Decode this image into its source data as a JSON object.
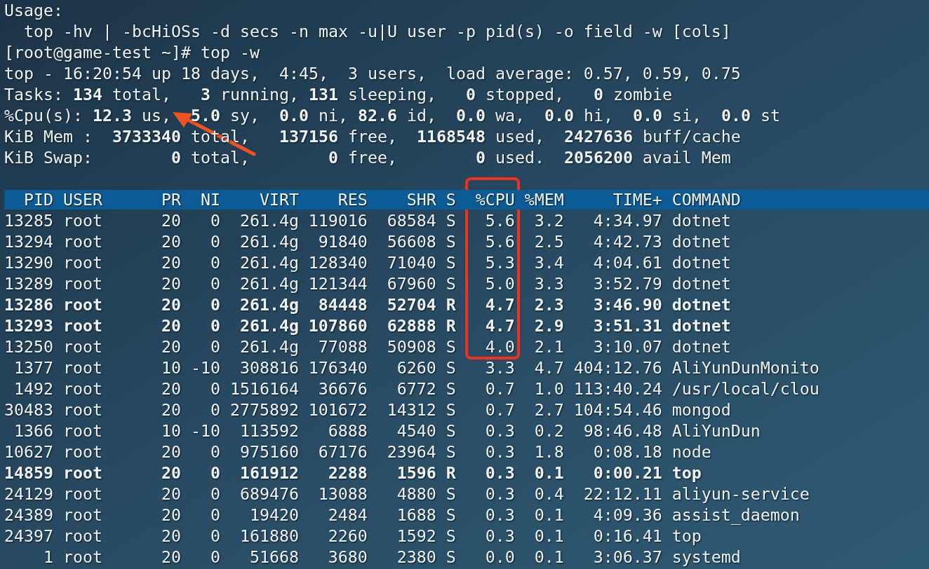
{
  "lines": [
    {
      "text": "Usage:"
    },
    {
      "text": "  top -hv | -bcHiOSs -d secs -n max -u|U user -p pid(s) -o field -w [cols]"
    },
    {
      "text": "[root@game-test ~]# top -w"
    },
    {
      "text": "top - 16:20:54 up 18 days,  4:45,  3 users,  load average: 0.57, 0.59, 0.75"
    },
    {
      "text": "Tasks: **134** total,   **3** running, **131** sleeping,   **0** stopped,   **0** zombie"
    },
    {
      "text": "%Cpu(s): **12.3** us,  **5.0** sy,  **0.0** ni, **82.6** id,  **0.0** wa,  **0.0** hi,  **0.0** si,  **0.0** st",
      "arrow": true
    },
    {
      "text": "KiB Mem :  **3733340** total,   **137156** free,  **1168548** used,  **2427636** buff/cache"
    },
    {
      "text": "KiB Swap:        **0** total,        **0** free,        **0** used.  **2056200** avail Mem"
    }
  ],
  "table": {
    "columns": [
      {
        "label": "PID",
        "annotated": false
      },
      {
        "label": "USER",
        "annotated": false
      },
      {
        "label": "PR",
        "annotated": false
      },
      {
        "label": "NI",
        "annotated": false
      },
      {
        "label": "VIRT",
        "annotated": false
      },
      {
        "label": "RES",
        "annotated": false
      },
      {
        "label": "SHR",
        "annotated": false
      },
      {
        "label": "S",
        "annotated": false
      },
      {
        "label": "%CPU",
        "annotated": true
      },
      {
        "label": "%MEM",
        "annotated": false
      },
      {
        "label": "TIME+",
        "annotated": false
      },
      {
        "label": "COMMAND",
        "annotated": false
      }
    ],
    "rows": [
      {
        "bold": false,
        "cells": [
          "13285",
          "root",
          "20",
          "0",
          "261.4g",
          "119016",
          "68584",
          "S",
          "5.6",
          "3.2",
          "4:34.97",
          "dotnet"
        ]
      },
      {
        "bold": false,
        "cells": [
          "13294",
          "root",
          "20",
          "0",
          "261.4g",
          "91840",
          "56608",
          "S",
          "5.6",
          "2.5",
          "4:42.73",
          "dotnet"
        ]
      },
      {
        "bold": false,
        "cells": [
          "13290",
          "root",
          "20",
          "0",
          "261.4g",
          "128340",
          "71040",
          "S",
          "5.3",
          "3.4",
          "4:04.61",
          "dotnet"
        ]
      },
      {
        "bold": false,
        "cells": [
          "13289",
          "root",
          "20",
          "0",
          "261.4g",
          "121344",
          "67960",
          "S",
          "5.0",
          "3.3",
          "3:52.79",
          "dotnet"
        ]
      },
      {
        "bold": true,
        "cells": [
          "13286",
          "root",
          "20",
          "0",
          "261.4g",
          "84448",
          "52704",
          "R",
          "4.7",
          "2.3",
          "3:46.90",
          "dotnet"
        ]
      },
      {
        "bold": true,
        "cells": [
          "13293",
          "root",
          "20",
          "0",
          "261.4g",
          "107860",
          "62888",
          "R",
          "4.7",
          "2.9",
          "3:51.31",
          "dotnet"
        ]
      },
      {
        "bold": false,
        "cells": [
          "13250",
          "root",
          "20",
          "0",
          "261.4g",
          "77088",
          "50908",
          "S",
          "4.0",
          "2.1",
          "3:10.07",
          "dotnet"
        ]
      },
      {
        "bold": false,
        "cells": [
          "1377",
          "root",
          "10",
          "-10",
          "308816",
          "176340",
          "6260",
          "S",
          "3.3",
          "4.7",
          "404:12.76",
          "AliYunDunMonito"
        ]
      },
      {
        "bold": false,
        "cells": [
          "1492",
          "root",
          "20",
          "0",
          "1516164",
          "36676",
          "6772",
          "S",
          "0.7",
          "1.0",
          "113:40.24",
          "/usr/local/clou"
        ]
      },
      {
        "bold": false,
        "cells": [
          "30483",
          "root",
          "20",
          "0",
          "2775892",
          "101672",
          "14312",
          "S",
          "0.7",
          "2.7",
          "104:54.46",
          "mongod"
        ]
      },
      {
        "bold": false,
        "cells": [
          "1366",
          "root",
          "10",
          "-10",
          "113592",
          "6888",
          "4540",
          "S",
          "0.3",
          "0.2",
          "98:46.48",
          "AliYunDun"
        ]
      },
      {
        "bold": false,
        "cells": [
          "10627",
          "root",
          "20",
          "0",
          "975160",
          "67176",
          "23964",
          "S",
          "0.3",
          "1.8",
          "0:08.18",
          "node"
        ]
      },
      {
        "bold": true,
        "cells": [
          "14859",
          "root",
          "20",
          "0",
          "161912",
          "2288",
          "1596",
          "R",
          "0.3",
          "0.1",
          "0:00.21",
          "top"
        ]
      },
      {
        "bold": false,
        "cells": [
          "24129",
          "root",
          "20",
          "0",
          "689476",
          "13088",
          "4880",
          "S",
          "0.3",
          "0.4",
          "22:12.11",
          "aliyun-service"
        ]
      },
      {
        "bold": false,
        "cells": [
          "24389",
          "root",
          "20",
          "0",
          "19420",
          "2484",
          "1688",
          "S",
          "0.3",
          "0.1",
          "4:09.36",
          "assist_daemon"
        ]
      },
      {
        "bold": false,
        "cells": [
          "24397",
          "root",
          "20",
          "0",
          "161880",
          "2260",
          "1592",
          "S",
          "0.3",
          "0.1",
          "0:16.41",
          "top"
        ]
      },
      {
        "bold": false,
        "cells": [
          "1",
          "root",
          "20",
          "0",
          "51668",
          "3680",
          "2380",
          "S",
          "0.0",
          "0.1",
          "3:06.37",
          "systemd"
        ]
      }
    ]
  }
}
